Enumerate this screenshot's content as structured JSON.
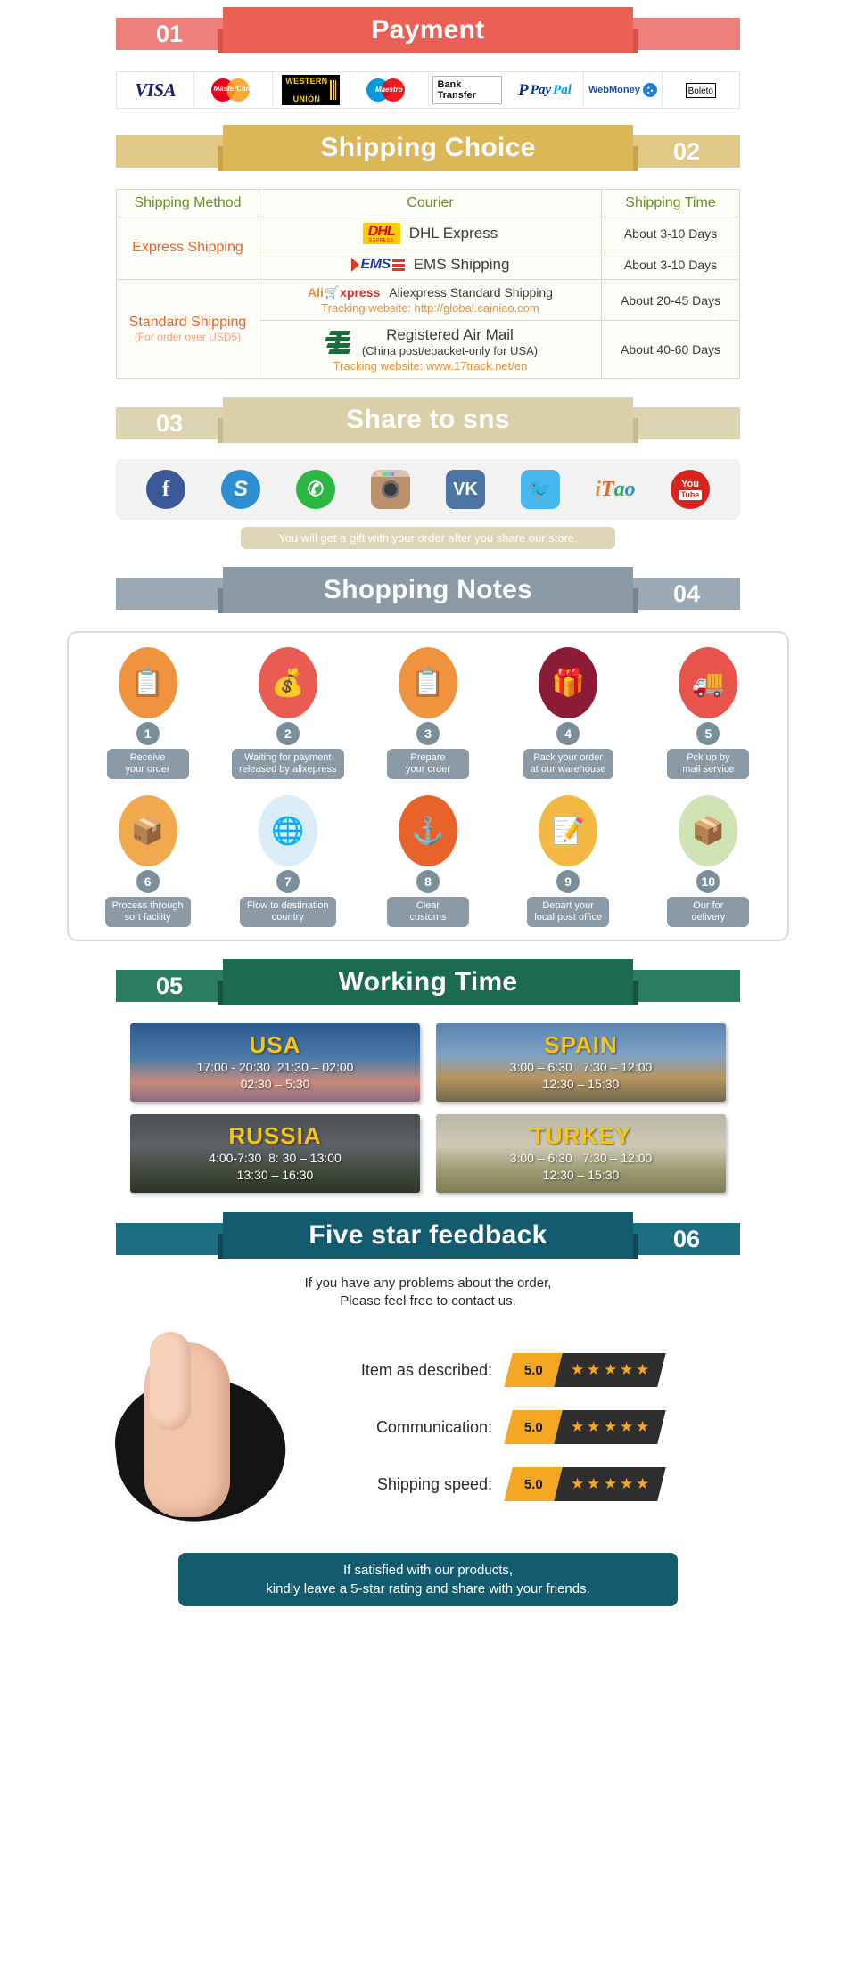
{
  "sections": {
    "payment": {
      "number": "01",
      "title": "Payment",
      "num_side": "left",
      "color": "#ea6055",
      "shade": "#d6544a",
      "tail": "#ef8079"
    },
    "shipping": {
      "number": "02",
      "title": "Shipping Choice",
      "num_side": "right",
      "color": "#dcb758",
      "shade": "#c9a449",
      "tail": "#e0c887"
    },
    "share": {
      "number": "03",
      "title": "Share to sns",
      "num_side": "left",
      "color": "#d9cfa8",
      "shade": "#c6bc94",
      "tail": "#ddd4b2"
    },
    "notes": {
      "number": "04",
      "title": "Shopping Notes",
      "num_side": "right",
      "color": "#8a9aa6",
      "shade": "#76858f",
      "tail": "#9aa9b4"
    },
    "working": {
      "number": "05",
      "title": "Working Time",
      "num_side": "left",
      "color": "#1b6b52",
      "shade": "#155443",
      "tail": "#2b7d62"
    },
    "feedback": {
      "number": "06",
      "title": "Five star feedback",
      "num_side": "right",
      "color": "#135b6e",
      "shade": "#0e4858",
      "tail": "#1d6e83"
    }
  },
  "payment_methods": [
    {
      "name": "visa",
      "label": "VISA"
    },
    {
      "name": "mastercard",
      "label": "MasterCard"
    },
    {
      "name": "western-union",
      "label1": "WESTERN",
      "label2": "UNION"
    },
    {
      "name": "maestro",
      "label": "Maestro"
    },
    {
      "name": "bank-transfer",
      "label": "Bank Transfer"
    },
    {
      "name": "paypal",
      "p": "P",
      "pay": "Pay",
      "pal": "Pal"
    },
    {
      "name": "webmoney",
      "label": "WebMoney"
    },
    {
      "name": "boleto",
      "label": "Boleto"
    }
  ],
  "shipping_table": {
    "headers": [
      "Shipping Method",
      "Courier",
      "Shipping Time"
    ],
    "rows": [
      {
        "method": "Express Shipping",
        "method_sub": "",
        "couriers": [
          {
            "logo": "dhl",
            "name": "DHL Express",
            "tracking": "",
            "time": "About 3-10 Days"
          },
          {
            "logo": "ems",
            "name": "EMS Shipping",
            "tracking": "",
            "time": "About 3-10 Days"
          }
        ]
      },
      {
        "method": "Standard Shipping",
        "method_sub": "(For order over USD5)",
        "couriers": [
          {
            "logo": "aliexpress",
            "name": "Aliexpress Standard Shipping",
            "tracking": "Tracking website: http://global.cainiao.com",
            "time": "About 20-45 Days"
          },
          {
            "logo": "chinapost",
            "name": "Registered Air Mail",
            "name_sub": "(China post/epacket-only for USA)",
            "tracking": "Tracking website: www.17track.net/en",
            "time": "About 40-60 Days"
          }
        ]
      }
    ]
  },
  "share": {
    "icons": [
      {
        "name": "facebook-icon",
        "glyph": "f"
      },
      {
        "name": "skype-icon",
        "glyph": "S"
      },
      {
        "name": "whatsapp-icon",
        "glyph": "✆"
      },
      {
        "name": "instagram-icon",
        "glyph": ""
      },
      {
        "name": "vk-icon",
        "glyph": "VK"
      },
      {
        "name": "twitter-icon",
        "glyph": "🐦"
      },
      {
        "name": "itao-icon",
        "glyph": "iTao"
      },
      {
        "name": "youtube-icon",
        "glyph": "You",
        "sub": "Tube"
      }
    ],
    "note": "You will get a gift with your order after you share our store."
  },
  "shopping_notes": [
    {
      "num": "1",
      "icon": "document-hand-icon",
      "glyph": "📋",
      "bg": "#f0933f",
      "label": "Receive\nyour order"
    },
    {
      "num": "2",
      "icon": "money-bag-icon",
      "glyph": "💰",
      "bg": "#ea5b51",
      "label": "Waiting for payment\nreleased by alixepress"
    },
    {
      "num": "3",
      "icon": "document-hand-icon",
      "glyph": "📋",
      "bg": "#f0933f",
      "label": "Prepare\nyour order"
    },
    {
      "num": "4",
      "icon": "gift-box-icon",
      "glyph": "🎁",
      "bg": "#8c1c36",
      "label": "Pack your order\nat our warehouse"
    },
    {
      "num": "5",
      "icon": "mail-truck-icon",
      "glyph": "🚚",
      "bg": "#e8544b",
      "label": "Pck up by\nmail service"
    },
    {
      "num": "6",
      "icon": "hand-truck-icon",
      "glyph": "📦",
      "bg": "#f0a94f",
      "label": "Process through\nsort facility"
    },
    {
      "num": "7",
      "icon": "globe-icon",
      "glyph": "🌐",
      "bg": "#d9ecf7",
      "label": "Flow to destination\ncountry"
    },
    {
      "num": "8",
      "icon": "anchor-icon",
      "glyph": "⚓",
      "bg": "#e8622a",
      "label": "Clear\ncustoms"
    },
    {
      "num": "9",
      "icon": "postman-icon",
      "glyph": "📝",
      "bg": "#f3b942",
      "label": "Depart your\nlocal post office"
    },
    {
      "num": "10",
      "icon": "parcel-icon",
      "glyph": "📦",
      "bg": "#cfe3b4",
      "label": "Our for\ndelivery"
    }
  ],
  "working_time": [
    {
      "country": "USA",
      "theme": "usa",
      "times": "17:00 - 20:30  21:30 – 02:00\n02:30 – 5:30"
    },
    {
      "country": "SPAIN",
      "theme": "spain",
      "times": "3:00 – 6:30   7:30 – 12:00\n12:30 – 15:30"
    },
    {
      "country": "RUSSIA",
      "theme": "russia",
      "times": "4:00-7:30  8: 30 – 13:00\n13:30 – 16:30"
    },
    {
      "country": "TURKEY",
      "theme": "turkey",
      "times": "3:00 – 6:30   7:30 – 12:00\n12:30 – 15:30"
    }
  ],
  "feedback": {
    "intro": "If you have any problems about the order,\nPlease feel free to contact us.",
    "ratings": [
      {
        "label": "Item as described:",
        "score": "5.0",
        "stars": 5
      },
      {
        "label": "Communication:",
        "score": "5.0",
        "stars": 5
      },
      {
        "label": "Shipping speed:",
        "score": "5.0",
        "stars": 5
      }
    ],
    "footer": "If satisfied with our products,\nkindly leave a 5-star rating and share with your friends."
  }
}
